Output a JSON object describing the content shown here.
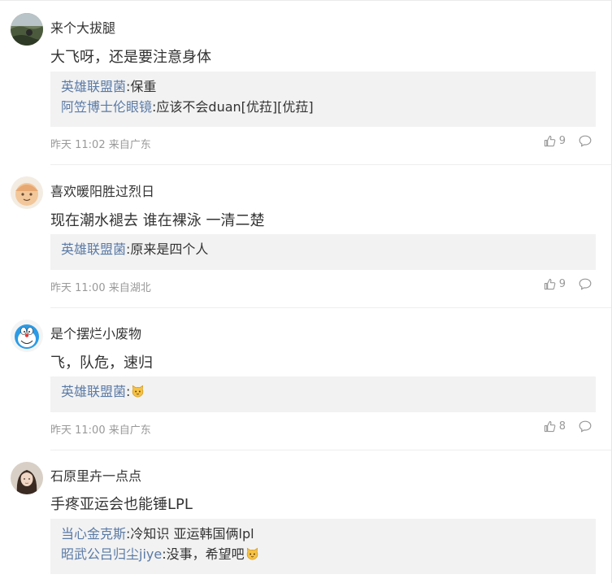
{
  "comments": [
    {
      "username": "来个大拔腿",
      "text": "大飞呀，还是要注意身体",
      "replies": [
        {
          "user": "英雄联盟菌",
          "text": ":保重",
          "emoji": ""
        },
        {
          "user": "阿笠博士伦眼镜",
          "text": ":应该不会duan[优菈][优菈]",
          "emoji": ""
        }
      ],
      "time": "昨天 11:02 来自广东",
      "likes": "9",
      "avatar": "landscape-avatar"
    },
    {
      "username": "喜欢暖阳胜过烈日",
      "text": "现在潮水褪去 谁在裸泳 一清二楚",
      "replies": [
        {
          "user": "英雄联盟菌",
          "text": ":原来是四个人",
          "emoji": ""
        }
      ],
      "time": "昨天 11:00 来自湖北",
      "likes": "9",
      "avatar": "hand-drawn-avatar"
    },
    {
      "username": "是个摆烂小废物",
      "text": "飞，队危，速归",
      "replies": [
        {
          "user": "英雄联盟菌",
          "text": ":",
          "emoji": "cat-emoji"
        }
      ],
      "time": "昨天 11:00 来自广东",
      "likes": "8",
      "avatar": "doraemon-avatar"
    },
    {
      "username": "石原里卉一点点",
      "text": "手疼亚运会也能锤LPL",
      "replies": [
        {
          "user": "当心金克斯",
          "text": ":冷知识 亚运韩国俩lpl",
          "emoji": ""
        },
        {
          "user": "昭武公吕归尘jiye",
          "text": ":没事，希望吧",
          "emoji": "cat-emoji"
        }
      ],
      "time": "",
      "likes": "",
      "avatar": "photo-avatar"
    }
  ],
  "colors": {
    "link": "#5a7aa6",
    "text": "#333333",
    "meta": "#999999",
    "reply_bg": "#f2f2f2"
  }
}
